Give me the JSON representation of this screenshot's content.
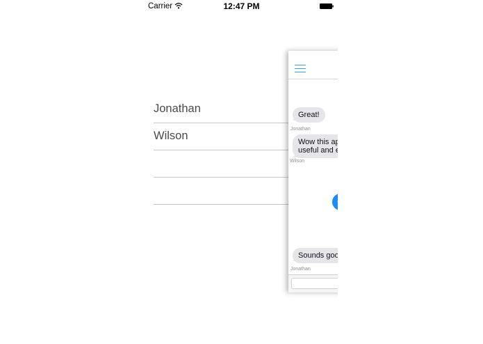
{
  "status_bar": {
    "carrier": "Carrier",
    "time": "12:47 PM",
    "battery": "full"
  },
  "contacts": [
    {
      "name": "Jonathan"
    },
    {
      "name": "Wilson"
    },
    {
      "name": ""
    },
    {
      "name": ""
    }
  ],
  "chat": {
    "nav_icon": "hamburger-menu-icon",
    "messages": [
      {
        "text": "Great!",
        "sender": "Jonathan"
      },
      {
        "lines": [
          "Wow this app",
          "useful and ea"
        ],
        "sender": "Wilson"
      },
      {
        "text": "Sounds good",
        "sender": "Jonathan"
      }
    ],
    "input_placeholder": ""
  },
  "colors": {
    "accent": "#3c9be9",
    "outgoing_bubble": "#1c8bf5",
    "incoming_bubble": "#e5e5ea",
    "separator": "#c8c7cc"
  }
}
